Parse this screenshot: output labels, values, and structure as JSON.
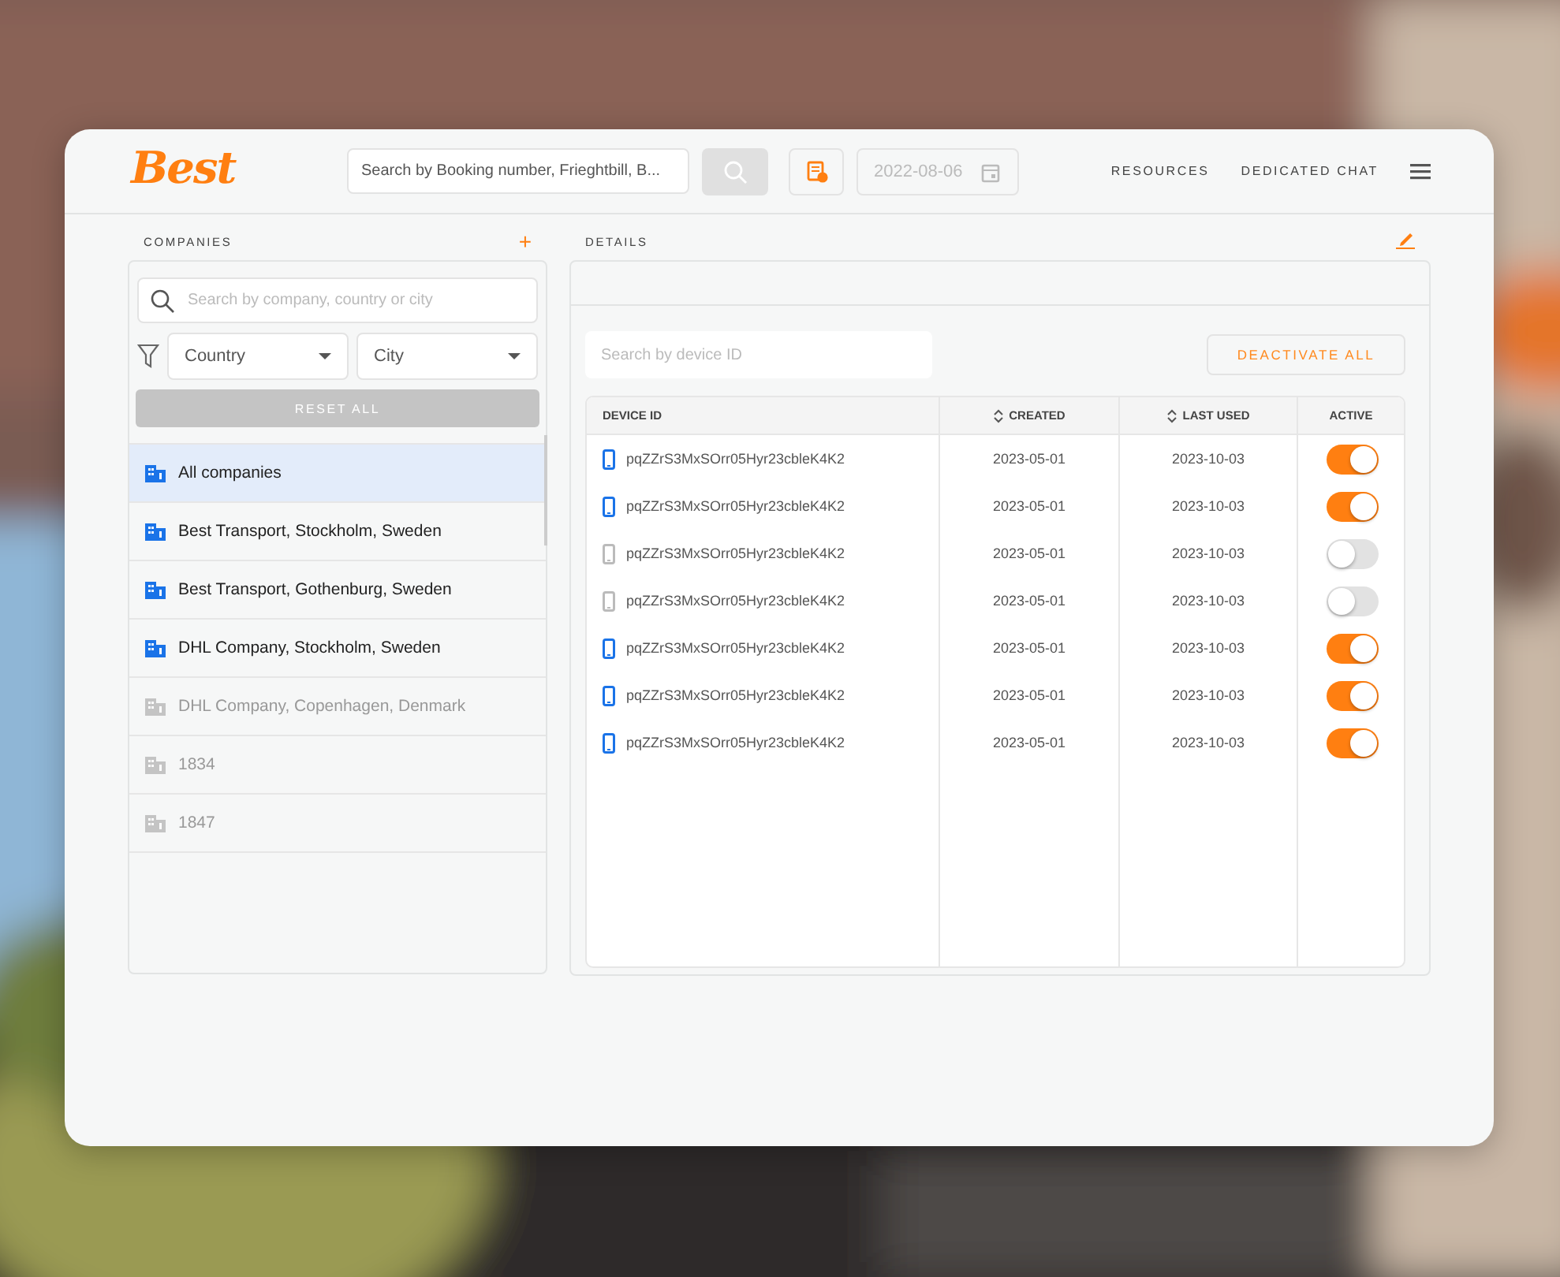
{
  "header": {
    "logo": "Best",
    "search": {
      "placeholder": "Search by Booking number, Frieghtbill, B..."
    },
    "date": {
      "placeholder": "2022-08-06"
    },
    "nav": [
      "RESOURCES",
      "DEDICATED CHAT"
    ]
  },
  "companies": {
    "title": "COMPANIES",
    "add": "+",
    "search": {
      "placeholder": "Search by company, country or city"
    },
    "filters": [
      "Country",
      "City"
    ],
    "reset": "RESET ALL",
    "items": [
      {
        "label": "All companies",
        "selected": true,
        "disabled": false
      },
      {
        "label": "Best Transport, Stockholm, Sweden",
        "selected": false,
        "disabled": false
      },
      {
        "label": "Best Transport, Gothenburg, Sweden",
        "selected": false,
        "disabled": false
      },
      {
        "label": "DHL Company, Stockholm, Sweden",
        "selected": false,
        "disabled": false
      },
      {
        "label": "DHL Company, Copenhagen, Denmark",
        "selected": false,
        "disabled": true
      },
      {
        "label": "1834",
        "selected": false,
        "disabled": true
      },
      {
        "label": "1847",
        "selected": false,
        "disabled": true
      }
    ]
  },
  "details": {
    "title": "DETAILS",
    "search": {
      "placeholder": "Search by device ID"
    },
    "deactivate": "DEACTIVATE ALL",
    "columns": [
      {
        "label": "DEVICE ID",
        "sortable": false
      },
      {
        "label": "CREATED",
        "sortable": true
      },
      {
        "label": "LAST USED",
        "sortable": true
      },
      {
        "label": "ACTIVE",
        "sortable": false
      }
    ],
    "rows": [
      {
        "device_id": "pqZZrS3MxSOrr05Hyr23cbleK4K2",
        "created": "2023-05-01",
        "last_used": "2023-10-03",
        "active": true
      },
      {
        "device_id": "pqZZrS3MxSOrr05Hyr23cbleK4K2",
        "created": "2023-05-01",
        "last_used": "2023-10-03",
        "active": true
      },
      {
        "device_id": "pqZZrS3MxSOrr05Hyr23cbleK4K2",
        "created": "2023-05-01",
        "last_used": "2023-10-03",
        "active": false
      },
      {
        "device_id": "pqZZrS3MxSOrr05Hyr23cbleK4K2",
        "created": "2023-05-01",
        "last_used": "2023-10-03",
        "active": false
      },
      {
        "device_id": "pqZZrS3MxSOrr05Hyr23cbleK4K2",
        "created": "2023-05-01",
        "last_used": "2023-10-03",
        "active": true
      },
      {
        "device_id": "pqZZrS3MxSOrr05Hyr23cbleK4K2",
        "created": "2023-05-01",
        "last_used": "2023-10-03",
        "active": true
      },
      {
        "device_id": "pqZZrS3MxSOrr05Hyr23cbleK4K2",
        "created": "2023-05-01",
        "last_used": "2023-10-03",
        "active": true
      }
    ]
  }
}
